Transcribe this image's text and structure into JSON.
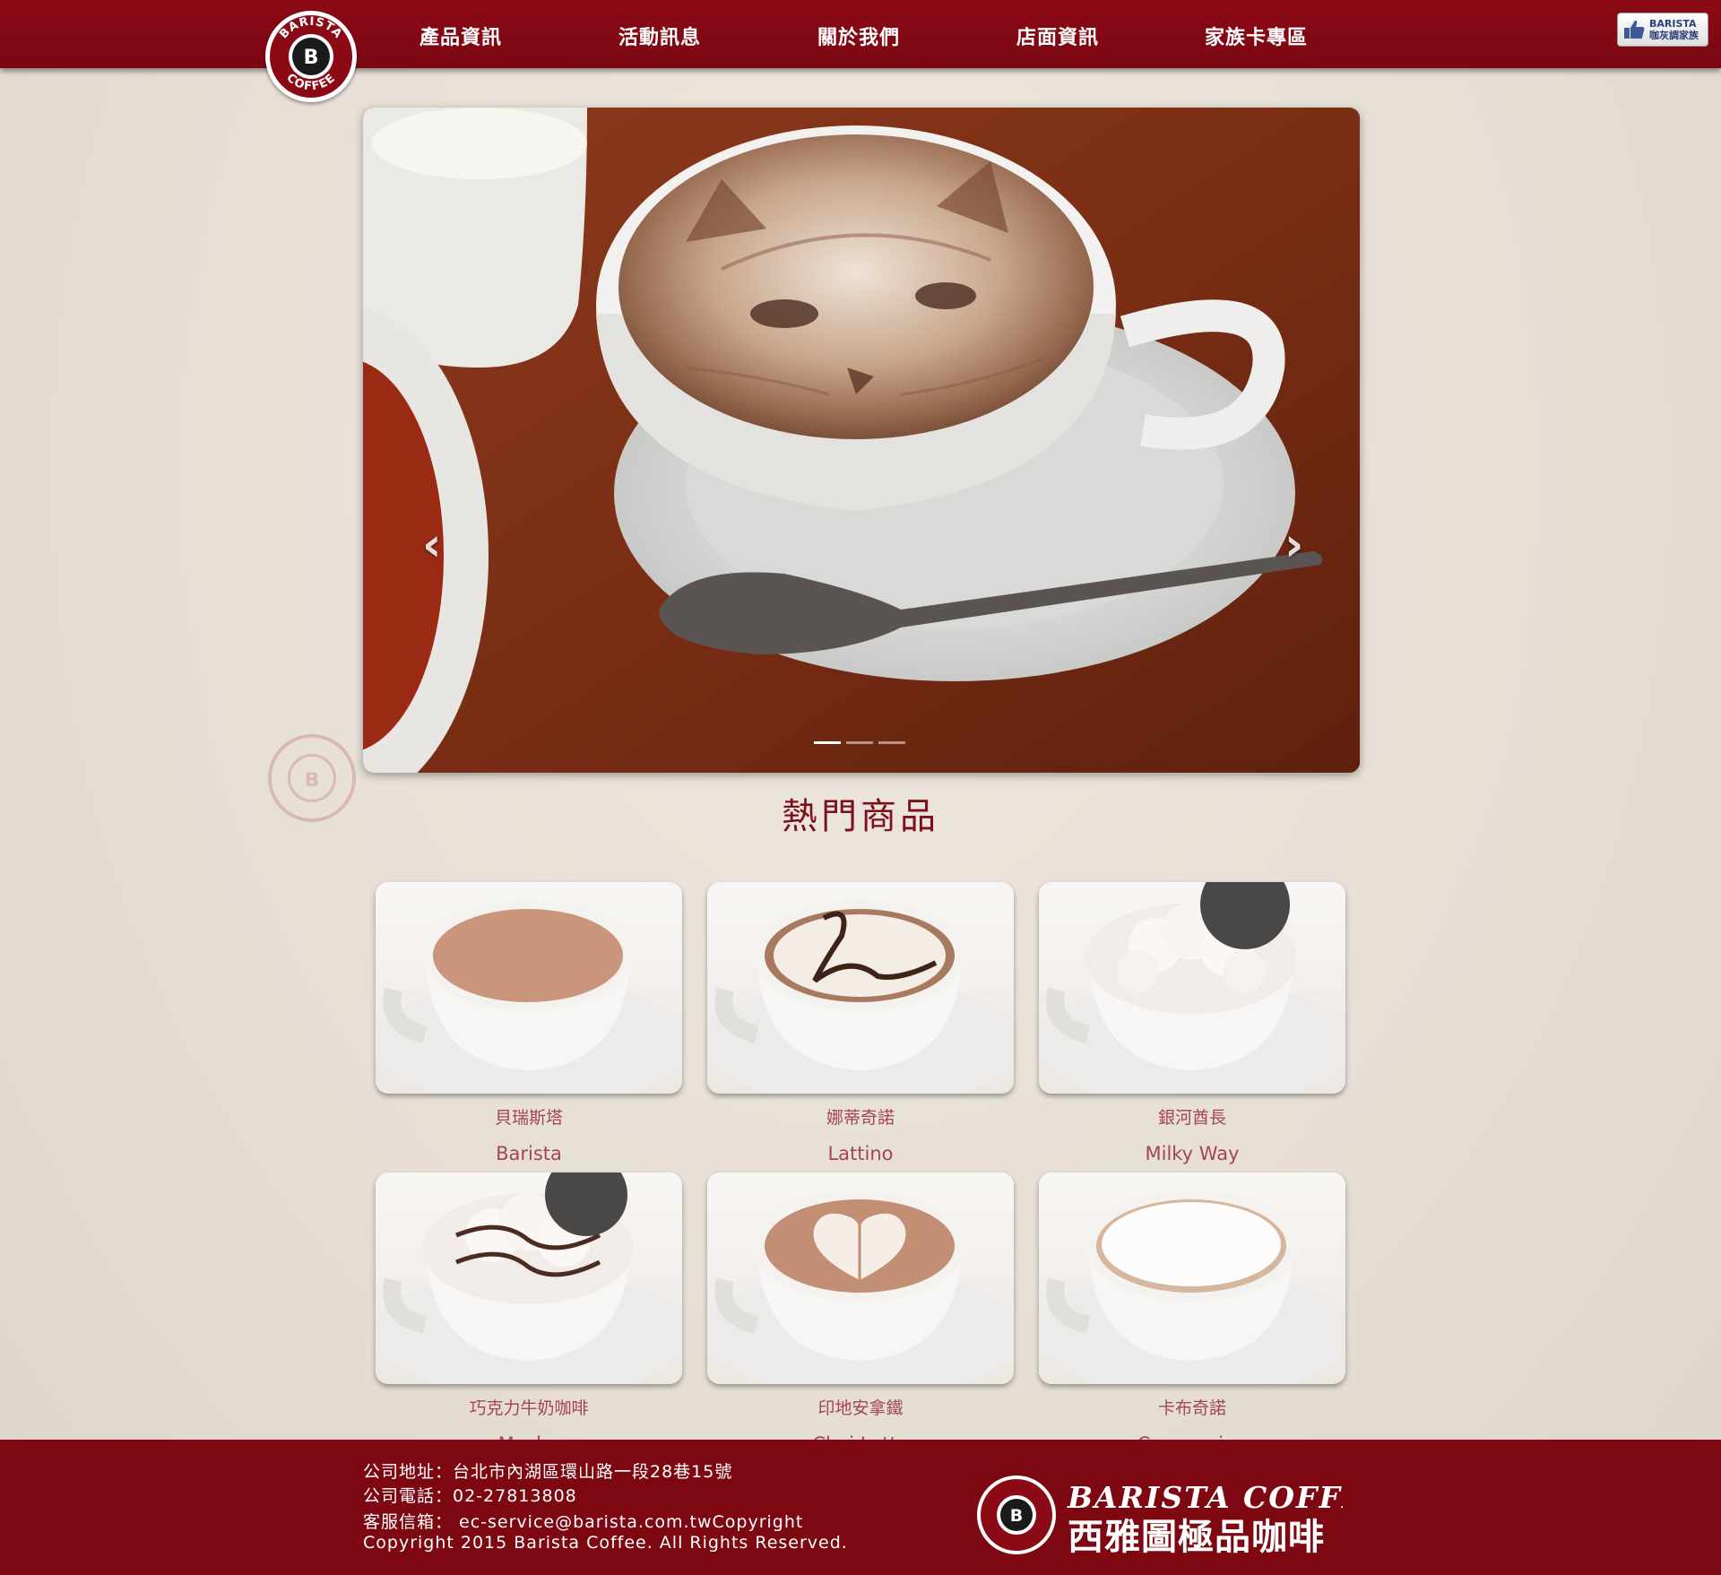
{
  "nav": {
    "items": [
      "產品資訊",
      "活動訊息",
      "關於我們",
      "店面資訊",
      "家族卡專區"
    ]
  },
  "logo": {
    "text_top": "BARISTA",
    "text_bottom": "COFFEE"
  },
  "fb_badge": {
    "line1": "BARISTA",
    "line2": "咖灰調家族",
    "icon": "thumbs-up-icon"
  },
  "carousel": {
    "slide_count": 3,
    "active_slide": 1,
    "prev_icon": "chevron-left-icon",
    "next_icon": "chevron-right-icon",
    "prev_glyph": "‹",
    "next_glyph": "›"
  },
  "section": {
    "title": "熱門商品"
  },
  "products": [
    {
      "zh": "貝瑞斯塔",
      "en": "Barista",
      "topping": "plain"
    },
    {
      "zh": "娜蒂奇諾",
      "en": "Lattino",
      "topping": "swirl"
    },
    {
      "zh": "銀河酋長",
      "en": "Milky Way",
      "topping": "cream-cookie"
    },
    {
      "zh": "巧克力牛奶咖啡",
      "en": "Mocha",
      "topping": "choco-cream"
    },
    {
      "zh": "印地安拿鐵",
      "en": "Chai Latte",
      "topping": "heart"
    },
    {
      "zh": "卡布奇諾",
      "en": "Cappuccino",
      "topping": "foam"
    }
  ],
  "footer": {
    "address": "公司地址：台北市內湖區環山路一段28巷15號",
    "phone": "公司電話：02-27813808",
    "email": "客服信箱： ec-service@barista.com.twCopyright",
    "copyright": "Copyright 2015 Barista Coffee. All Rights Reserved.",
    "brand_en": "BARISTA COFFEE",
    "brand_zh": "西雅圖極品咖啡"
  },
  "colors": {
    "brand_red": "#7e0812",
    "product_text": "#a5464f",
    "title_red": "#7c0f1a"
  }
}
